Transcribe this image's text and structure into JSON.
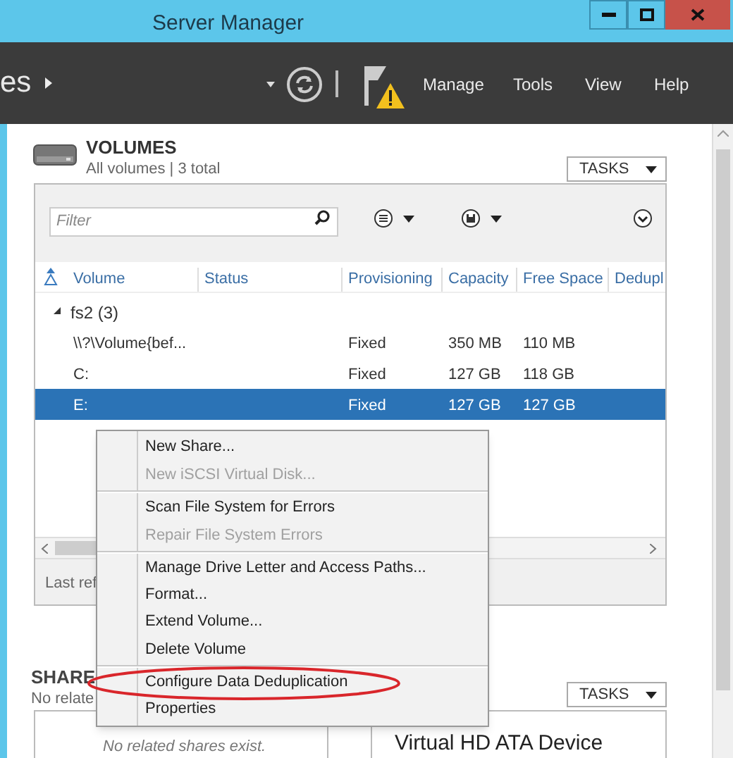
{
  "window": {
    "title": "Server Manager"
  },
  "toolbar": {
    "breadcrumb": "es",
    "menu": [
      "Manage",
      "Tools",
      "View",
      "Help"
    ]
  },
  "volumes": {
    "title": "VOLUMES",
    "subtitle": "All volumes | 3 total",
    "tasks": "TASKS",
    "filter": {
      "placeholder": "Filter"
    },
    "columns": [
      "Volume",
      "Status",
      "Provisioning",
      "Capacity",
      "Free Space",
      "Dedupl"
    ],
    "group": {
      "label": "fs2 (3)",
      "expanded": true
    },
    "rows": [
      {
        "cells": [
          "\\\\?\\Volume{bef...",
          "",
          "Fixed",
          "350 MB",
          "110 MB"
        ],
        "selected": false
      },
      {
        "cells": [
          "C:",
          "",
          "Fixed",
          "127 GB",
          "118 GB"
        ],
        "selected": false
      },
      {
        "cells": [
          "E:",
          "",
          "Fixed",
          "127 GB",
          "127 GB"
        ],
        "selected": true
      }
    ],
    "footer": "Last ref"
  },
  "context_menu": [
    {
      "label": "New Share...",
      "disabled": false,
      "separator_after": false,
      "circled": false
    },
    {
      "label": "New iSCSI Virtual Disk...",
      "disabled": true,
      "separator_after": true,
      "circled": false
    },
    {
      "label": "Scan File System for Errors",
      "disabled": false,
      "separator_after": false,
      "circled": false
    },
    {
      "label": "Repair File System Errors",
      "disabled": true,
      "separator_after": true,
      "circled": false
    },
    {
      "label": "Manage Drive Letter and Access Paths...",
      "disabled": false,
      "separator_after": false,
      "circled": false
    },
    {
      "label": "Format...",
      "disabled": false,
      "separator_after": false,
      "circled": false
    },
    {
      "label": "Extend Volume...",
      "disabled": false,
      "separator_after": false,
      "circled": false
    },
    {
      "label": "Delete Volume",
      "disabled": false,
      "separator_after": true,
      "circled": false
    },
    {
      "label": "Configure Data Deduplication",
      "disabled": false,
      "separator_after": false,
      "circled": true
    },
    {
      "label": "Properties",
      "disabled": false,
      "separator_after": false,
      "circled": false
    }
  ],
  "shares": {
    "title": "SHARE",
    "subtitle": "No relate",
    "tasks": "TASKS",
    "empty_message": "No related shares exist.",
    "device": "Virtual HD ATA Device"
  }
}
